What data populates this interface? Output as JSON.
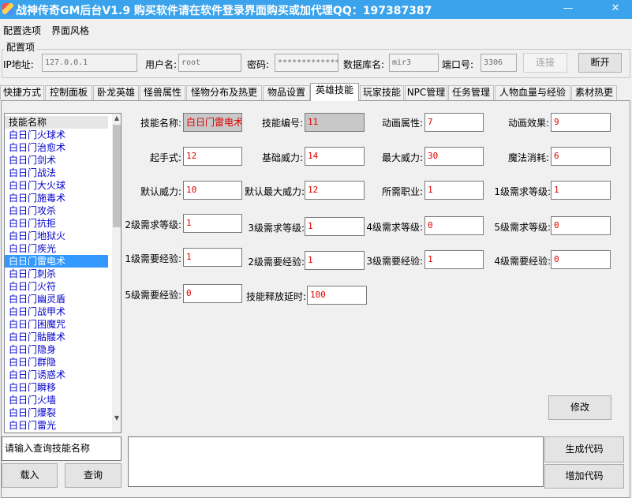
{
  "window": {
    "title": "战神传奇GM后台V1.9   购买软件请在软件登录界面购买或加代理QQ：197387387",
    "minimize": "—",
    "close": "✕"
  },
  "menu": [
    "配置选项",
    "界面风格"
  ],
  "config": {
    "legend": "配置项",
    "ip_label": "IP地址:",
    "ip_value": "127.0.0.1",
    "user_label": "用户名:",
    "user_value": "root",
    "pwd_label": "密码:",
    "pwd_value": "*************",
    "db_label": "数据库名:",
    "db_value": "mir3",
    "port_label": "端口号:",
    "port_value": "3306",
    "connect": "连接",
    "disconnect": "断开"
  },
  "tabs": [
    "快捷方式",
    "控制面板",
    "卧龙英雄",
    "怪兽属性",
    "怪物分布及热更",
    "物品设置",
    "英雄技能",
    "玩家技能",
    "NPC管理",
    "任务管理",
    "人物血量与经验",
    "素材热更"
  ],
  "active_tab": "英雄技能",
  "skill_list": {
    "header": "技能名称",
    "items": [
      "白日门火球术",
      "白日门治愈术",
      "白日门剑术",
      "白日门战法",
      "白日门大火球",
      "白日门施毒术",
      "白日门攻杀",
      "白日门抗拒",
      "白日门地狱火",
      "白日门疾光",
      "白日门雷电术",
      "白日门刺杀",
      "白日门火符",
      "白日门幽灵盾",
      "白日门战甲术",
      "白日门困魔咒",
      "白日门骷髅术",
      "白日门隐身",
      "白日门群隐",
      "白日门诱惑术",
      "白日门瞬移",
      "白日门火墙",
      "白日门爆裂",
      "白日门雷光"
    ],
    "selected": "白日门雷电术"
  },
  "form": {
    "skill_name_label": "技能名称:",
    "skill_name": "白日门雷电术",
    "skill_id_label": "技能编号:",
    "skill_id": "11",
    "anim_attr_label": "动画属性:",
    "anim_attr": "7",
    "anim_effect_label": "动画效果:",
    "anim_effect": "9",
    "start_label": "起手式:",
    "start": "12",
    "base_power_label": "基础威力:",
    "base_power": "14",
    "max_power_label": "最大威力:",
    "max_power": "30",
    "mana_label": "魔法消耗:",
    "mana": "6",
    "def_power_label": "默认威力:",
    "def_power": "10",
    "def_max_power_label": "默认最大威力:",
    "def_max_power": "12",
    "job_label": "所需职业:",
    "job": "1",
    "lv1_req_label": "1级需求等级:",
    "lv1_req": "1",
    "lv2_req_label": "2级需求等级:",
    "lv2_req": "1",
    "lv3_req_label": "3级需求等级:",
    "lv3_req": "1",
    "lv4_req_label": "4级需求等级:",
    "lv4_req": "0",
    "lv5_req_label": "5级需求等级:",
    "lv5_req": "0",
    "lv1_exp_label": "1级需要经验:",
    "lv1_exp": "1",
    "lv2_exp_label": "2级需要经验:",
    "lv2_exp": "1",
    "lv3_exp_label": "3级需要经验:",
    "lv3_exp": "1",
    "lv4_exp_label": "4级需要经验:",
    "lv4_exp": "0",
    "lv5_exp_label": "5级需要经验:",
    "lv5_exp": "0",
    "delay_label": "技能释放延时:",
    "delay": "100"
  },
  "buttons": {
    "modify": "修改",
    "search_placeholder": "请输入查询技能名称",
    "load": "载入",
    "query": "查询",
    "generate": "生成代码",
    "add": "增加代码"
  }
}
